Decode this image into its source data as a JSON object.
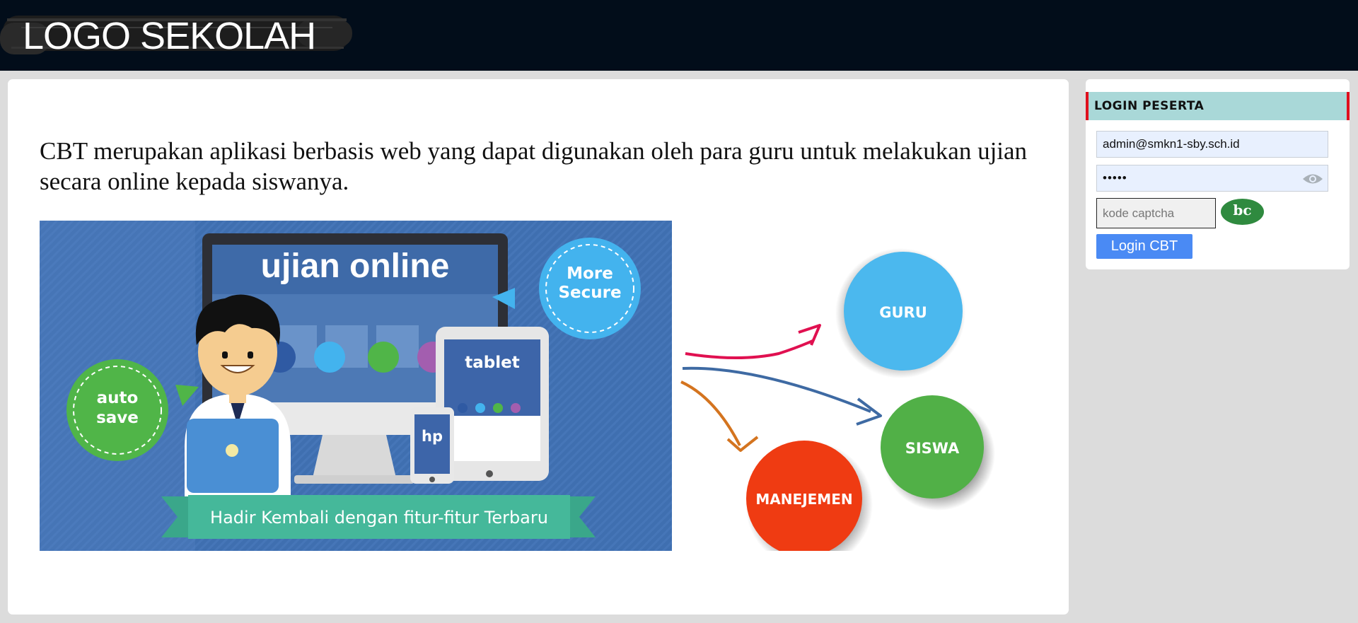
{
  "header": {
    "logo_text": "LOGO SEKOLAH"
  },
  "main": {
    "intro_text": "CBT merupakan aplikasi berbasis web yang dapat digunakan oleh para guru untuk melakukan ujian secara online kepada siswanya.",
    "banner": {
      "title": "ujian online",
      "bubble_secure": [
        "More",
        "Secure"
      ],
      "bubble_autosave": [
        "auto",
        "save"
      ],
      "tablet_label": "tablet",
      "phone_label": "hp",
      "ribbon_text": "Hadir Kembali dengan fitur-fitur Terbaru"
    },
    "roles": {
      "guru": "GURU",
      "siswa": "SISWA",
      "manejemen": "MANEJEMEN"
    }
  },
  "login": {
    "title": "LOGIN PESERTA",
    "username_value": "admin@smkn1-sby.sch.id",
    "password_value": "•••••",
    "captcha_placeholder": "kode captcha",
    "captcha_code": "bc",
    "button_label": "Login CBT"
  },
  "colors": {
    "topbar": "#020d1a",
    "login_header_bg": "#a9d8d8",
    "login_header_border": "#e0101e",
    "button": "#4a8af4",
    "guru": "#4bb8ee",
    "siswa": "#51b047",
    "manejemen": "#ef3b12"
  },
  "icons": {
    "password_toggle": "eye-icon"
  }
}
